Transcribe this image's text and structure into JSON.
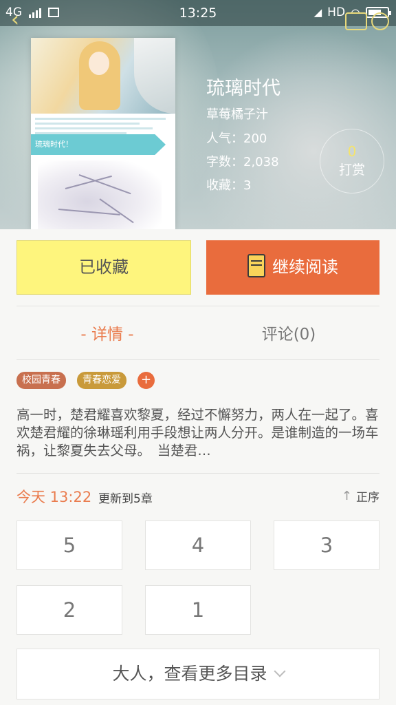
{
  "status_bar": {
    "network": "4G",
    "time": "13:25",
    "hd": "HD"
  },
  "book": {
    "title": "琉璃时代",
    "author": "草莓橘子汁",
    "popularity": "人气：200",
    "word_count": "字数：2,038",
    "favorites": "收藏：3",
    "cover_ribbon_text": "琉璃时代！"
  },
  "tip": {
    "count": "0",
    "label": "打赏"
  },
  "actions": {
    "favorite_label": "已收藏",
    "continue_label": "继续阅读"
  },
  "tabs": {
    "detail": "- 详情 -",
    "comment": "评论(0)"
  },
  "tags": [
    {
      "label": "校园青春",
      "color": "#c8704f"
    },
    {
      "label": "青春恋爱",
      "color": "#c99a3a"
    }
  ],
  "tag_add": "+",
  "synopsis": "高一时，楚君耀喜欢黎夏，经过不懈努力，两人在一起了。喜欢楚君耀的徐琳瑶利用手段想让两人分开。是谁制造的一场车祸，让黎夏失去父母。　当楚君…",
  "update": {
    "time": "今天 13:22",
    "text": "更新到5章",
    "sort_label": "正序"
  },
  "chapters": [
    "5",
    "4",
    "3",
    "2",
    "1"
  ],
  "more_catalog": "大人，查看更多目录",
  "colors": {
    "accent": "#e96c3d",
    "favorite_bg": "#fef57d",
    "tab_active": "#ea7c4e"
  }
}
